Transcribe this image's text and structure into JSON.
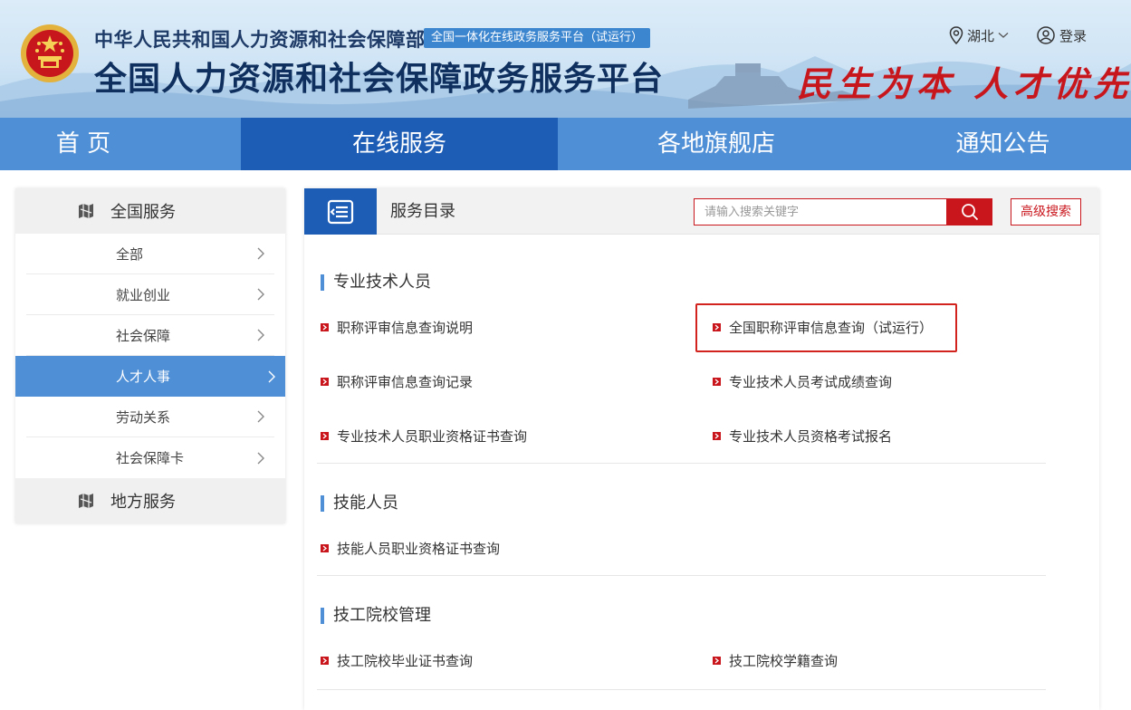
{
  "header": {
    "ministry_name": "中华人民共和国人力资源和社会保障部",
    "trial_badge": "全国一体化在线政务服务平台（试运行）",
    "platform_title": "全国人力资源和社会保障政务服务平台",
    "slogan": "民生为本 人才优先",
    "region": "湖北",
    "login": "登录"
  },
  "nav": {
    "items": [
      {
        "label": "首 页"
      },
      {
        "label": "在线服务"
      },
      {
        "label": "各地旗舰店"
      },
      {
        "label": "通知公告"
      }
    ]
  },
  "sidebar": {
    "national_label": "全国服务",
    "items": [
      {
        "label": "全部"
      },
      {
        "label": "就业创业"
      },
      {
        "label": "社会保障"
      },
      {
        "label": "人才人事"
      },
      {
        "label": "劳动关系"
      },
      {
        "label": "社会保障卡"
      }
    ],
    "local_label": "地方服务"
  },
  "main": {
    "title": "服务目录",
    "search": {
      "placeholder": "请输入搜索关键字"
    },
    "advanced_search": "高级搜索",
    "sections": [
      {
        "title": "专业技术人员",
        "links": [
          "职称评审信息查询说明",
          "全国职称评审信息查询（试运行）",
          "职称评审信息查询记录",
          "专业技术人员考试成绩查询",
          "专业技术人员职业资格证书查询",
          "专业技术人员资格考试报名"
        ]
      },
      {
        "title": "技能人员",
        "links": [
          "技能人员职业资格证书查询"
        ]
      },
      {
        "title": "技工院校管理",
        "links": [
          "技工院校毕业证书查询",
          "技工院校学籍查询"
        ]
      }
    ]
  },
  "colors": {
    "nav_bg": "#4f8fd6",
    "nav_active": "#1e5db6",
    "accent_red": "#c9161d",
    "title_dark": "#0f2f5e"
  }
}
